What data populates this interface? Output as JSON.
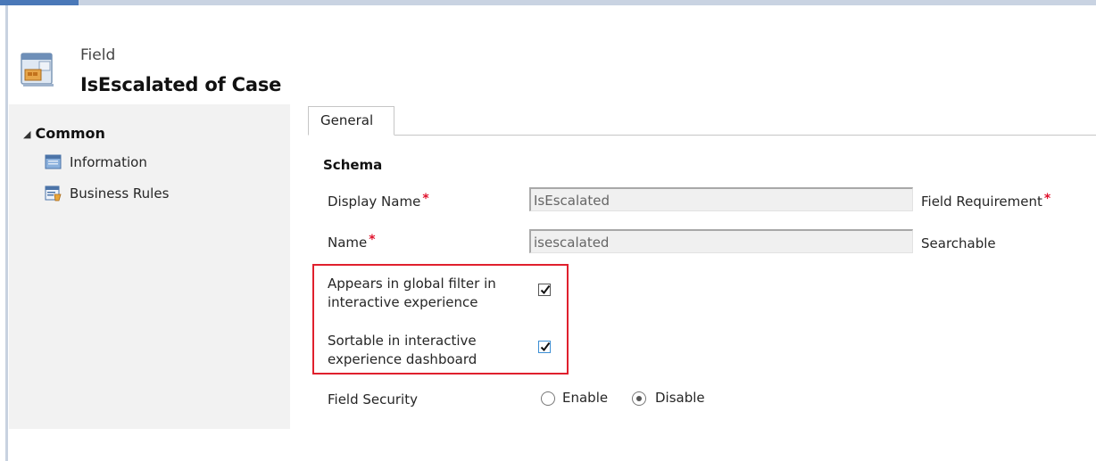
{
  "header": {
    "kind": "Field",
    "title": "IsEscalated of Case"
  },
  "nav": {
    "section_label": "Common",
    "items": [
      {
        "label": "Information",
        "icon": "information-icon"
      },
      {
        "label": "Business Rules",
        "icon": "business-rules-icon"
      }
    ]
  },
  "tabs": [
    {
      "label": "General",
      "selected": true
    }
  ],
  "form": {
    "section_title": "Schema",
    "display_name": {
      "label": "Display Name",
      "value": "IsEscalated",
      "required": true
    },
    "name": {
      "label": "Name",
      "value": "isescalated",
      "required": true
    },
    "field_requirement": {
      "label": "Field Requirement",
      "required": true
    },
    "searchable": {
      "label": "Searchable"
    },
    "global_filter": {
      "label_line1": "Appears in global filter in",
      "label_line2": "interactive experience",
      "checked": true
    },
    "sortable": {
      "label_line1": "Sortable in interactive",
      "label_line2": "experience dashboard",
      "checked": true
    },
    "field_security": {
      "label": "Field Security",
      "options": [
        {
          "label": "Enable",
          "selected": false
        },
        {
          "label": "Disable",
          "selected": true
        }
      ]
    },
    "required_mark": "*"
  },
  "colors": {
    "accent": "#4a78b8",
    "required": "#e0112b",
    "highlight": "#e0202d",
    "nav_background": "#f2f2f2"
  }
}
